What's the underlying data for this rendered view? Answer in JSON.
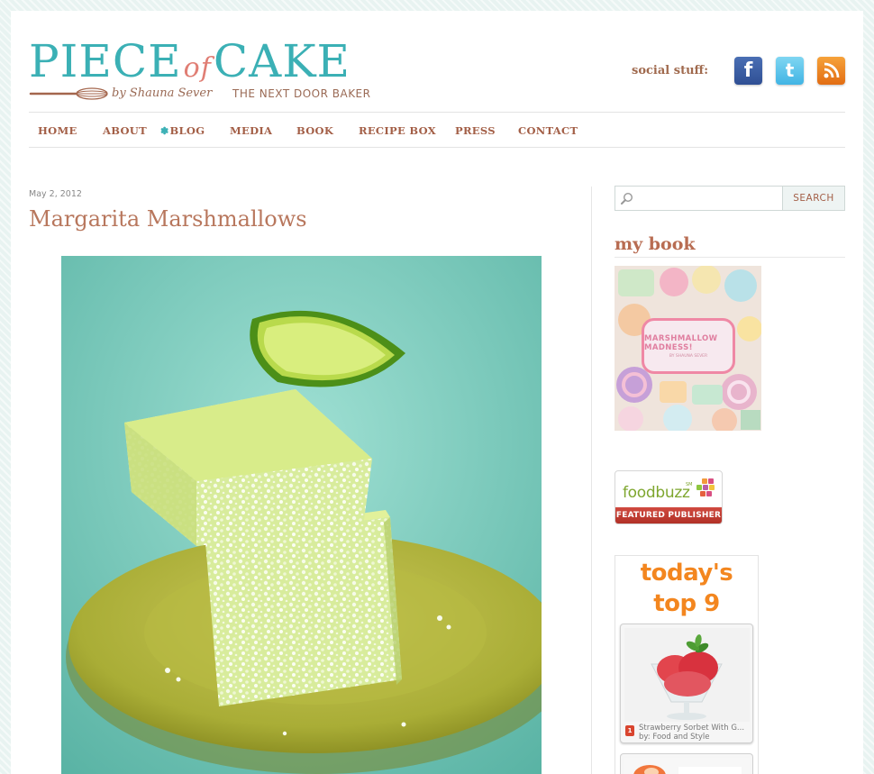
{
  "header": {
    "logo": {
      "main_part1": "PIECE",
      "main_of": "of",
      "main_part2": "CAKE",
      "byline": "by Shauna Sever",
      "tagline": "THE NEXT DOOR BAKER"
    },
    "social": {
      "label": "social stuff:",
      "icons": [
        "facebook-icon",
        "twitter-icon",
        "rss-icon"
      ],
      "facebook_glyph": "f",
      "twitter_glyph": "t"
    }
  },
  "nav": {
    "items": [
      {
        "label": "HOME"
      },
      {
        "label": "ABOUT"
      },
      {
        "label": "BLOG",
        "active": true
      },
      {
        "label": "MEDIA"
      },
      {
        "label": "BOOK"
      },
      {
        "label": "RECIPE BOX"
      },
      {
        "label": "PRESS"
      },
      {
        "label": "CONTACT"
      }
    ]
  },
  "post": {
    "date": "May 2, 2012",
    "title": "Margarita Marshmallows"
  },
  "sidebar": {
    "search": {
      "placeholder": "",
      "button_label": "SEARCH"
    },
    "my_book": {
      "heading": "my book",
      "cover_title": "MARSHMALLOW MADNESS!",
      "cover_subtitle": "BY SHAUNA SEVER"
    },
    "foodbuzz": {
      "name": "foodbuzz",
      "sm": "SM",
      "band": "FEATURED PUBLISHER"
    },
    "top9": {
      "heading_line1": "today's",
      "heading_line2": "top 9",
      "items": [
        {
          "rank": "1",
          "title": "Strawberry Sorbet With G...",
          "by": "by: Food and Style"
        }
      ]
    }
  },
  "colors": {
    "teal": "#3bb0b5",
    "coral": "#e07e74",
    "brown": "#a35f47",
    "title": "#b8775d",
    "orange": "#f3861f",
    "foodbuzz_red": "#c23d33"
  }
}
